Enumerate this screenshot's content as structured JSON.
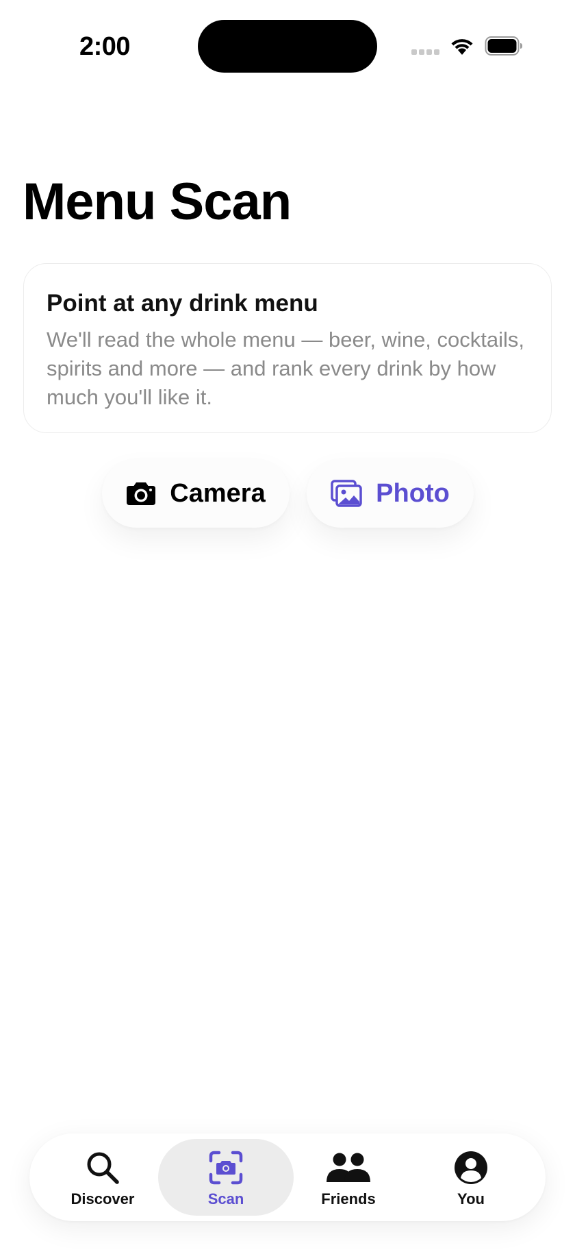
{
  "status_bar": {
    "time": "2:00"
  },
  "page": {
    "title": "Menu Scan"
  },
  "info_card": {
    "heading": "Point at any drink menu",
    "body": "We'll read the whole menu — beer, wine, cocktails, spirits and more — and rank every drink by how much you'll like it."
  },
  "actions": {
    "camera_label": "Camera",
    "photo_label": "Photo"
  },
  "tabs": [
    {
      "label": "Discover",
      "icon": "search-icon"
    },
    {
      "label": "Scan",
      "icon": "scan-camera-icon",
      "active": true
    },
    {
      "label": "Friends",
      "icon": "people-icon"
    },
    {
      "label": "You",
      "icon": "profile-icon"
    }
  ],
  "colors": {
    "accent": "#5b4ed1",
    "text_primary": "#000000",
    "text_secondary": "#8a8a8a",
    "tab_active_bg": "#ececec"
  }
}
